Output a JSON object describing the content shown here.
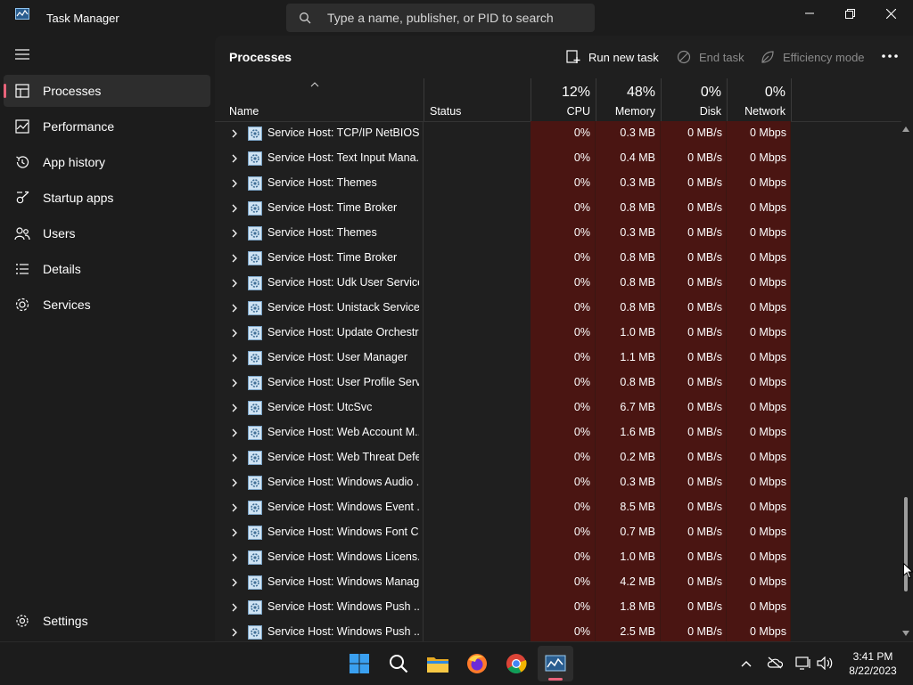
{
  "window": {
    "title": "Task Manager",
    "search_placeholder": "Type a name, publisher, or PID to search"
  },
  "nav": {
    "items": [
      {
        "label": "Processes",
        "icon": "processes-icon",
        "active": true
      },
      {
        "label": "Performance",
        "icon": "performance-icon"
      },
      {
        "label": "App history",
        "icon": "app-history-icon"
      },
      {
        "label": "Startup apps",
        "icon": "startup-apps-icon"
      },
      {
        "label": "Users",
        "icon": "users-icon"
      },
      {
        "label": "Details",
        "icon": "details-icon"
      },
      {
        "label": "Services",
        "icon": "services-icon"
      }
    ],
    "settings_label": "Settings"
  },
  "page": {
    "title": "Processes",
    "run_new_task": "Run new task",
    "end_task": "End task",
    "efficiency_mode": "Efficiency mode"
  },
  "columns": {
    "name": "Name",
    "status": "Status",
    "cpu": {
      "pct": "12%",
      "label": "CPU"
    },
    "memory": {
      "pct": "48%",
      "label": "Memory"
    },
    "disk": {
      "pct": "0%",
      "label": "Disk"
    },
    "network": {
      "pct": "0%",
      "label": "Network"
    }
  },
  "rows": [
    {
      "name": "Service Host: TCP/IP NetBIOS ...",
      "cpu": "0%",
      "memory": "0.3 MB",
      "disk": "0 MB/s",
      "network": "0 Mbps"
    },
    {
      "name": "Service Host: Text Input Mana...",
      "cpu": "0%",
      "memory": "0.4 MB",
      "disk": "0 MB/s",
      "network": "0 Mbps"
    },
    {
      "name": "Service Host: Themes",
      "cpu": "0%",
      "memory": "0.3 MB",
      "disk": "0 MB/s",
      "network": "0 Mbps"
    },
    {
      "name": "Service Host: Time Broker",
      "cpu": "0%",
      "memory": "0.8 MB",
      "disk": "0 MB/s",
      "network": "0 Mbps"
    },
    {
      "name": "Service Host: Themes",
      "cpu": "0%",
      "memory": "0.3 MB",
      "disk": "0 MB/s",
      "network": "0 Mbps"
    },
    {
      "name": "Service Host: Time Broker",
      "cpu": "0%",
      "memory": "0.8 MB",
      "disk": "0 MB/s",
      "network": "0 Mbps"
    },
    {
      "name": "Service Host: Udk User Service...",
      "cpu": "0%",
      "memory": "0.8 MB",
      "disk": "0 MB/s",
      "network": "0 Mbps"
    },
    {
      "name": "Service Host: Unistack Service ...",
      "cpu": "0%",
      "memory": "0.8 MB",
      "disk": "0 MB/s",
      "network": "0 Mbps"
    },
    {
      "name": "Service Host: Update Orchestr...",
      "cpu": "0%",
      "memory": "1.0 MB",
      "disk": "0 MB/s",
      "network": "0 Mbps"
    },
    {
      "name": "Service Host: User Manager",
      "cpu": "0%",
      "memory": "1.1 MB",
      "disk": "0 MB/s",
      "network": "0 Mbps"
    },
    {
      "name": "Service Host: User Profile Servi...",
      "cpu": "0%",
      "memory": "0.8 MB",
      "disk": "0 MB/s",
      "network": "0 Mbps"
    },
    {
      "name": "Service Host: UtcSvc",
      "cpu": "0%",
      "memory": "6.7 MB",
      "disk": "0 MB/s",
      "network": "0 Mbps"
    },
    {
      "name": "Service Host: Web Account M...",
      "cpu": "0%",
      "memory": "1.6 MB",
      "disk": "0 MB/s",
      "network": "0 Mbps"
    },
    {
      "name": "Service Host: Web Threat Defe...",
      "cpu": "0%",
      "memory": "0.2 MB",
      "disk": "0 MB/s",
      "network": "0 Mbps"
    },
    {
      "name": "Service Host: Windows Audio ...",
      "cpu": "0%",
      "memory": "0.3 MB",
      "disk": "0 MB/s",
      "network": "0 Mbps"
    },
    {
      "name": "Service Host: Windows Event ...",
      "cpu": "0%",
      "memory": "8.5 MB",
      "disk": "0 MB/s",
      "network": "0 Mbps"
    },
    {
      "name": "Service Host: Windows Font C...",
      "cpu": "0%",
      "memory": "0.7 MB",
      "disk": "0 MB/s",
      "network": "0 Mbps"
    },
    {
      "name": "Service Host: Windows Licens...",
      "cpu": "0%",
      "memory": "1.0 MB",
      "disk": "0 MB/s",
      "network": "0 Mbps"
    },
    {
      "name": "Service Host: Windows Manag...",
      "cpu": "0%",
      "memory": "4.2 MB",
      "disk": "0 MB/s",
      "network": "0 Mbps"
    },
    {
      "name": "Service Host: Windows Push ...",
      "cpu": "0%",
      "memory": "1.8 MB",
      "disk": "0 MB/s",
      "network": "0 Mbps"
    },
    {
      "name": "Service Host: Windows Push ...",
      "cpu": "0%",
      "memory": "2.5 MB",
      "disk": "0 MB/s",
      "network": "0 Mbps"
    }
  ],
  "taskbar": {
    "apps": [
      "windows-start-icon",
      "search-icon",
      "file-explorer-icon",
      "firefox-icon",
      "chrome-icon",
      "task-manager-icon"
    ],
    "time": "3:41 PM",
    "date": "8/22/2023"
  },
  "colors": {
    "accent": "#e8637a",
    "heatmap": "#4a1512",
    "background": "#1f1f1f"
  }
}
